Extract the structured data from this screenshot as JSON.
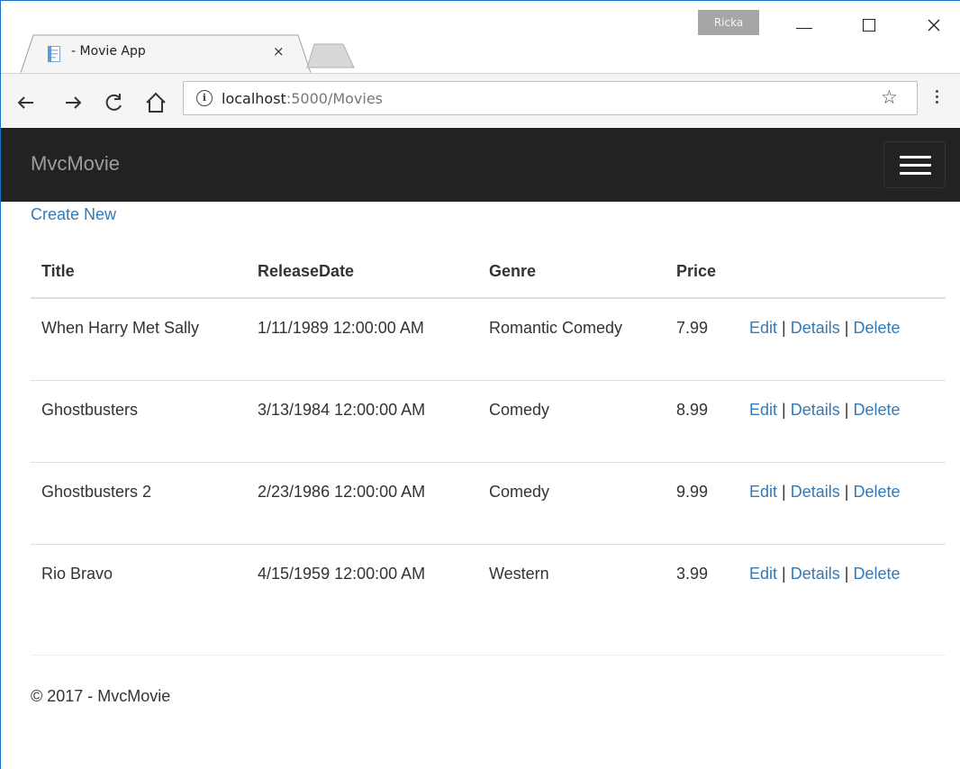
{
  "window": {
    "user_badge": "Ricka",
    "tab_title": "- Movie App",
    "tab_close": "×",
    "min_label": "",
    "close_glyph": "✕"
  },
  "toolbar": {
    "back_glyph": "←",
    "forward_glyph": "→",
    "reload_glyph": "C",
    "home_glyph": "⌂",
    "info_glyph": "i",
    "url_host": "localhost",
    "url_path": ":5000/Movies",
    "star_glyph": "☆"
  },
  "navbar": {
    "brand": "MvcMovie"
  },
  "content": {
    "create_new": "Create New",
    "table": {
      "headers": [
        "Title",
        "ReleaseDate",
        "Genre",
        "Price",
        ""
      ],
      "rows": [
        {
          "title": "When Harry Met Sally",
          "release_date": "1/11/1989 12:00:00 AM",
          "genre": "Romantic Comedy",
          "price": "7.99"
        },
        {
          "title": "Ghostbusters",
          "release_date": "3/13/1984 12:00:00 AM",
          "genre": "Comedy",
          "price": "8.99"
        },
        {
          "title": "Ghostbusters 2",
          "release_date": "2/23/1986 12:00:00 AM",
          "genre": "Comedy",
          "price": "9.99"
        },
        {
          "title": "Rio Bravo",
          "release_date": "4/15/1959 12:00:00 AM",
          "genre": "Western",
          "price": "3.99"
        }
      ],
      "action_labels": {
        "edit": "Edit",
        "details": "Details",
        "delete": "Delete",
        "separator": "|"
      }
    }
  },
  "footer": {
    "text": "© 2017 - MvcMovie"
  },
  "colors": {
    "navbar_bg": "#222222",
    "brand": "#9d9d9d",
    "link": "#337ab7",
    "text": "#333333",
    "border": "#dddddd"
  }
}
